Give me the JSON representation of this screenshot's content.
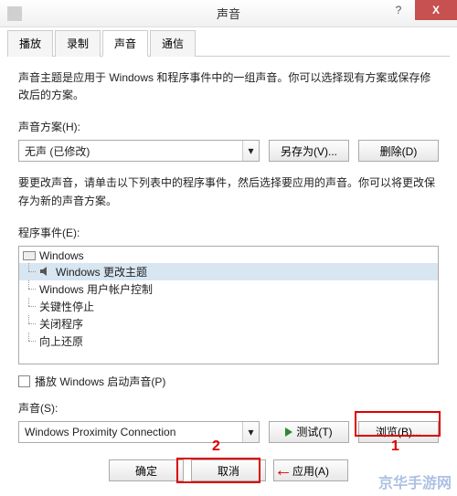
{
  "window": {
    "title": "声音",
    "help": "?",
    "close": "X"
  },
  "tabs": [
    {
      "label": "播放",
      "active": false
    },
    {
      "label": "录制",
      "active": false
    },
    {
      "label": "声音",
      "active": true
    },
    {
      "label": "通信",
      "active": false
    }
  ],
  "main": {
    "description": "声音主题是应用于 Windows 和程序事件中的一组声音。你可以选择现有方案或保存修改后的方案。",
    "scheme_label": "声音方案(H):",
    "scheme_value": "无声 (已修改)",
    "save_as": "另存为(V)...",
    "delete": "删除(D)",
    "events_desc": "要更改声音，请单击以下列表中的程序事件，然后选择要应用的声音。你可以将更改保存为新的声音方案。",
    "events_label": "程序事件(E):",
    "tree_root": "Windows",
    "tree_items": [
      {
        "label": "Windows 更改主题",
        "selected": true,
        "has_sound": true
      },
      {
        "label": "Windows 用户帐户控制",
        "selected": false,
        "has_sound": false
      },
      {
        "label": "关键性停止",
        "selected": false,
        "has_sound": false
      },
      {
        "label": "关闭程序",
        "selected": false,
        "has_sound": false
      },
      {
        "label": "向上还原",
        "selected": false,
        "has_sound": false
      }
    ],
    "startup_checkbox": "播放 Windows 启动声音(P)",
    "sound_label": "声音(S):",
    "sound_value": "Windows Proximity Connection",
    "test": "测试(T)",
    "browse": "浏览(B)..."
  },
  "footer": {
    "ok": "确定",
    "cancel": "取消",
    "apply": "应用(A)"
  },
  "annotations": {
    "marker1": "1",
    "marker2": "2",
    "arrow": "←",
    "watermark": "京华手游网"
  }
}
